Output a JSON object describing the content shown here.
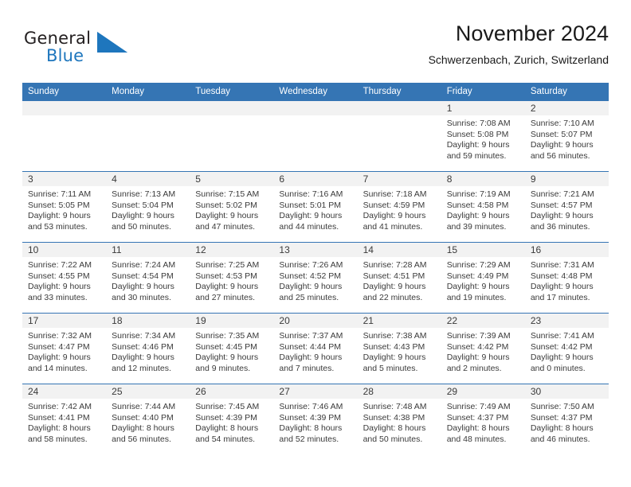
{
  "brand": {
    "name_top": "General",
    "name_bottom": "Blue",
    "triangle_icon": "blue-triangle-icon",
    "colors": {
      "dark": "#231f20",
      "blue": "#1e76bd"
    }
  },
  "header": {
    "title": "November 2024",
    "subtitle": "Schwerzenbach, Zurich, Switzerland"
  },
  "theme": {
    "header_bg": "#3575b4",
    "daynum_bg": "#f2f2f2",
    "text": "#3a3a3a",
    "cell_border": "#3575b4"
  },
  "calendar": {
    "weekday_headers": [
      "Sunday",
      "Monday",
      "Tuesday",
      "Wednesday",
      "Thursday",
      "Friday",
      "Saturday"
    ],
    "labels": {
      "sunrise": "Sunrise:",
      "sunset": "Sunset:",
      "daylight": "Daylight:"
    },
    "weeks": [
      [
        {
          "day": "",
          "empty": true,
          "line1": "",
          "line2": "",
          "line3": "",
          "line4": ""
        },
        {
          "day": "",
          "empty": true,
          "line1": "",
          "line2": "",
          "line3": "",
          "line4": ""
        },
        {
          "day": "",
          "empty": true,
          "line1": "",
          "line2": "",
          "line3": "",
          "line4": ""
        },
        {
          "day": "",
          "empty": true,
          "line1": "",
          "line2": "",
          "line3": "",
          "line4": ""
        },
        {
          "day": "",
          "empty": true,
          "line1": "",
          "line2": "",
          "line3": "",
          "line4": ""
        },
        {
          "day": "1",
          "empty": false,
          "line1": "Sunrise: 7:08 AM",
          "line2": "Sunset: 5:08 PM",
          "line3": "Daylight: 9 hours",
          "line4": "and 59 minutes."
        },
        {
          "day": "2",
          "empty": false,
          "line1": "Sunrise: 7:10 AM",
          "line2": "Sunset: 5:07 PM",
          "line3": "Daylight: 9 hours",
          "line4": "and 56 minutes."
        }
      ],
      [
        {
          "day": "3",
          "empty": false,
          "line1": "Sunrise: 7:11 AM",
          "line2": "Sunset: 5:05 PM",
          "line3": "Daylight: 9 hours",
          "line4": "and 53 minutes."
        },
        {
          "day": "4",
          "empty": false,
          "line1": "Sunrise: 7:13 AM",
          "line2": "Sunset: 5:04 PM",
          "line3": "Daylight: 9 hours",
          "line4": "and 50 minutes."
        },
        {
          "day": "5",
          "empty": false,
          "line1": "Sunrise: 7:15 AM",
          "line2": "Sunset: 5:02 PM",
          "line3": "Daylight: 9 hours",
          "line4": "and 47 minutes."
        },
        {
          "day": "6",
          "empty": false,
          "line1": "Sunrise: 7:16 AM",
          "line2": "Sunset: 5:01 PM",
          "line3": "Daylight: 9 hours",
          "line4": "and 44 minutes."
        },
        {
          "day": "7",
          "empty": false,
          "line1": "Sunrise: 7:18 AM",
          "line2": "Sunset: 4:59 PM",
          "line3": "Daylight: 9 hours",
          "line4": "and 41 minutes."
        },
        {
          "day": "8",
          "empty": false,
          "line1": "Sunrise: 7:19 AM",
          "line2": "Sunset: 4:58 PM",
          "line3": "Daylight: 9 hours",
          "line4": "and 39 minutes."
        },
        {
          "day": "9",
          "empty": false,
          "line1": "Sunrise: 7:21 AM",
          "line2": "Sunset: 4:57 PM",
          "line3": "Daylight: 9 hours",
          "line4": "and 36 minutes."
        }
      ],
      [
        {
          "day": "10",
          "empty": false,
          "line1": "Sunrise: 7:22 AM",
          "line2": "Sunset: 4:55 PM",
          "line3": "Daylight: 9 hours",
          "line4": "and 33 minutes."
        },
        {
          "day": "11",
          "empty": false,
          "line1": "Sunrise: 7:24 AM",
          "line2": "Sunset: 4:54 PM",
          "line3": "Daylight: 9 hours",
          "line4": "and 30 minutes."
        },
        {
          "day": "12",
          "empty": false,
          "line1": "Sunrise: 7:25 AM",
          "line2": "Sunset: 4:53 PM",
          "line3": "Daylight: 9 hours",
          "line4": "and 27 minutes."
        },
        {
          "day": "13",
          "empty": false,
          "line1": "Sunrise: 7:26 AM",
          "line2": "Sunset: 4:52 PM",
          "line3": "Daylight: 9 hours",
          "line4": "and 25 minutes."
        },
        {
          "day": "14",
          "empty": false,
          "line1": "Sunrise: 7:28 AM",
          "line2": "Sunset: 4:51 PM",
          "line3": "Daylight: 9 hours",
          "line4": "and 22 minutes."
        },
        {
          "day": "15",
          "empty": false,
          "line1": "Sunrise: 7:29 AM",
          "line2": "Sunset: 4:49 PM",
          "line3": "Daylight: 9 hours",
          "line4": "and 19 minutes."
        },
        {
          "day": "16",
          "empty": false,
          "line1": "Sunrise: 7:31 AM",
          "line2": "Sunset: 4:48 PM",
          "line3": "Daylight: 9 hours",
          "line4": "and 17 minutes."
        }
      ],
      [
        {
          "day": "17",
          "empty": false,
          "line1": "Sunrise: 7:32 AM",
          "line2": "Sunset: 4:47 PM",
          "line3": "Daylight: 9 hours",
          "line4": "and 14 minutes."
        },
        {
          "day": "18",
          "empty": false,
          "line1": "Sunrise: 7:34 AM",
          "line2": "Sunset: 4:46 PM",
          "line3": "Daylight: 9 hours",
          "line4": "and 12 minutes."
        },
        {
          "day": "19",
          "empty": false,
          "line1": "Sunrise: 7:35 AM",
          "line2": "Sunset: 4:45 PM",
          "line3": "Daylight: 9 hours",
          "line4": "and 9 minutes."
        },
        {
          "day": "20",
          "empty": false,
          "line1": "Sunrise: 7:37 AM",
          "line2": "Sunset: 4:44 PM",
          "line3": "Daylight: 9 hours",
          "line4": "and 7 minutes."
        },
        {
          "day": "21",
          "empty": false,
          "line1": "Sunrise: 7:38 AM",
          "line2": "Sunset: 4:43 PM",
          "line3": "Daylight: 9 hours",
          "line4": "and 5 minutes."
        },
        {
          "day": "22",
          "empty": false,
          "line1": "Sunrise: 7:39 AM",
          "line2": "Sunset: 4:42 PM",
          "line3": "Daylight: 9 hours",
          "line4": "and 2 minutes."
        },
        {
          "day": "23",
          "empty": false,
          "line1": "Sunrise: 7:41 AM",
          "line2": "Sunset: 4:42 PM",
          "line3": "Daylight: 9 hours",
          "line4": "and 0 minutes."
        }
      ],
      [
        {
          "day": "24",
          "empty": false,
          "line1": "Sunrise: 7:42 AM",
          "line2": "Sunset: 4:41 PM",
          "line3": "Daylight: 8 hours",
          "line4": "and 58 minutes."
        },
        {
          "day": "25",
          "empty": false,
          "line1": "Sunrise: 7:44 AM",
          "line2": "Sunset: 4:40 PM",
          "line3": "Daylight: 8 hours",
          "line4": "and 56 minutes."
        },
        {
          "day": "26",
          "empty": false,
          "line1": "Sunrise: 7:45 AM",
          "line2": "Sunset: 4:39 PM",
          "line3": "Daylight: 8 hours",
          "line4": "and 54 minutes."
        },
        {
          "day": "27",
          "empty": false,
          "line1": "Sunrise: 7:46 AM",
          "line2": "Sunset: 4:39 PM",
          "line3": "Daylight: 8 hours",
          "line4": "and 52 minutes."
        },
        {
          "day": "28",
          "empty": false,
          "line1": "Sunrise: 7:48 AM",
          "line2": "Sunset: 4:38 PM",
          "line3": "Daylight: 8 hours",
          "line4": "and 50 minutes."
        },
        {
          "day": "29",
          "empty": false,
          "line1": "Sunrise: 7:49 AM",
          "line2": "Sunset: 4:37 PM",
          "line3": "Daylight: 8 hours",
          "line4": "and 48 minutes."
        },
        {
          "day": "30",
          "empty": false,
          "line1": "Sunrise: 7:50 AM",
          "line2": "Sunset: 4:37 PM",
          "line3": "Daylight: 8 hours",
          "line4": "and 46 minutes."
        }
      ]
    ]
  }
}
